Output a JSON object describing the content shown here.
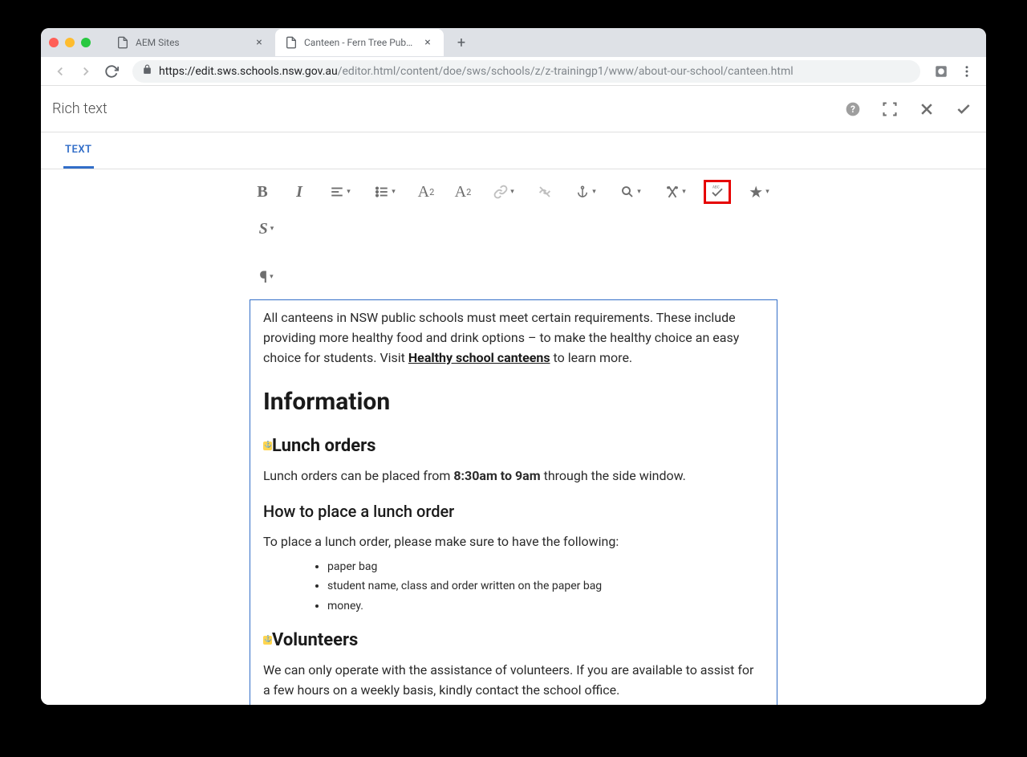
{
  "browser": {
    "tabs": [
      {
        "title": "AEM Sites",
        "active": false
      },
      {
        "title": "Canteen - Fern Tree Public Sch",
        "active": true
      }
    ],
    "url_domain": "https://edit.sws.schools.nsw.gov.au",
    "url_path": "/editor.html/content/doe/sws/schools/z/z-trainingp1/www/about-our-school/canteen.html"
  },
  "dialog": {
    "title": "Rich text",
    "tab_label": "TEXT"
  },
  "toolbar": {
    "bold": "B",
    "italic": "I",
    "subscript_sub": "2",
    "superscript_sup": "2",
    "paraformat": "¶",
    "star": "★",
    "style_s": "S"
  },
  "content": {
    "intro_part1": "All canteens in NSW public schools must meet certain requirements. These include providing more healthy food and drink options – to make the healthy choice an easy choice for students. Visit ",
    "intro_link": "Healthy school canteens",
    "intro_part2": " to learn more.",
    "h2_information": "Information",
    "h3_lunch_orders": "Lunch orders",
    "lunch_text_1": "Lunch orders can be placed from ",
    "lunch_time_bold": "8:30am to 9am",
    "lunch_text_2": " through the side window.",
    "h4_how_to": "How to place a lunch order",
    "how_to_intro": "To place a lunch order, please make sure to have the following:",
    "list_items": [
      "paper bag",
      "student name, class and order written on the paper bag",
      "money."
    ],
    "h3_volunteers": "Volunteers",
    "volunteers_text": "We can only operate with the assistance of volunteers. If you are available to assist for a few hours on a weekly basis, kindly contact the school office."
  }
}
